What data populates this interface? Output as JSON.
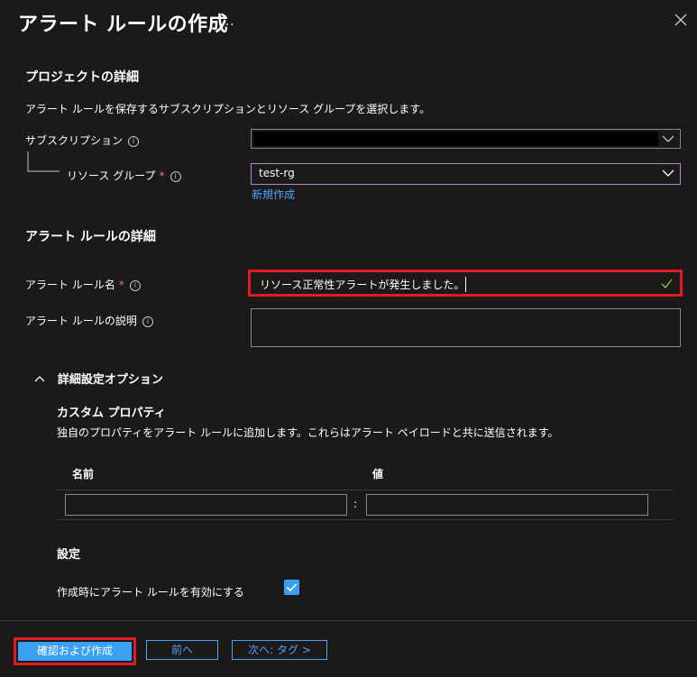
{
  "header": {
    "title": "アラート ルールの作成",
    "more_label": "…"
  },
  "project": {
    "section_title": "プロジェクトの詳細",
    "description": "アラート ルールを保存するサブスクリプションとリソース グループを選択します。",
    "subscription_label": "サブスクリプション",
    "subscription_value": "",
    "resource_group_label": "リソース グループ",
    "resource_group_value": "test-rg",
    "create_new_link": "新規作成"
  },
  "rule": {
    "section_title": "アラート ルールの詳細",
    "name_label": "アラート ルール名",
    "name_value": "リソース正常性アラートが発生しました。",
    "description_label": "アラート ルールの説明",
    "description_value": ""
  },
  "advanced": {
    "toggle_label": "詳細設定オプション",
    "custom_title": "カスタム プロパティ",
    "custom_description": "独自のプロパティをアラート ルールに追加します。これらはアラート ペイロードと共に送信されます。",
    "col_name": "名前",
    "col_value": "値",
    "separator": ":",
    "settings_title": "設定",
    "enable_label": "作成時にアラート ルールを有効にする",
    "enable_checked": true
  },
  "footer": {
    "review_create": "確認および作成",
    "previous": "前へ",
    "next": "次へ: タグ >"
  },
  "colors": {
    "background": "#1b1a19",
    "accent": "#3aa0f3",
    "highlight": "#e01b24",
    "link": "#4ea1ff",
    "required": "#f1707b"
  }
}
